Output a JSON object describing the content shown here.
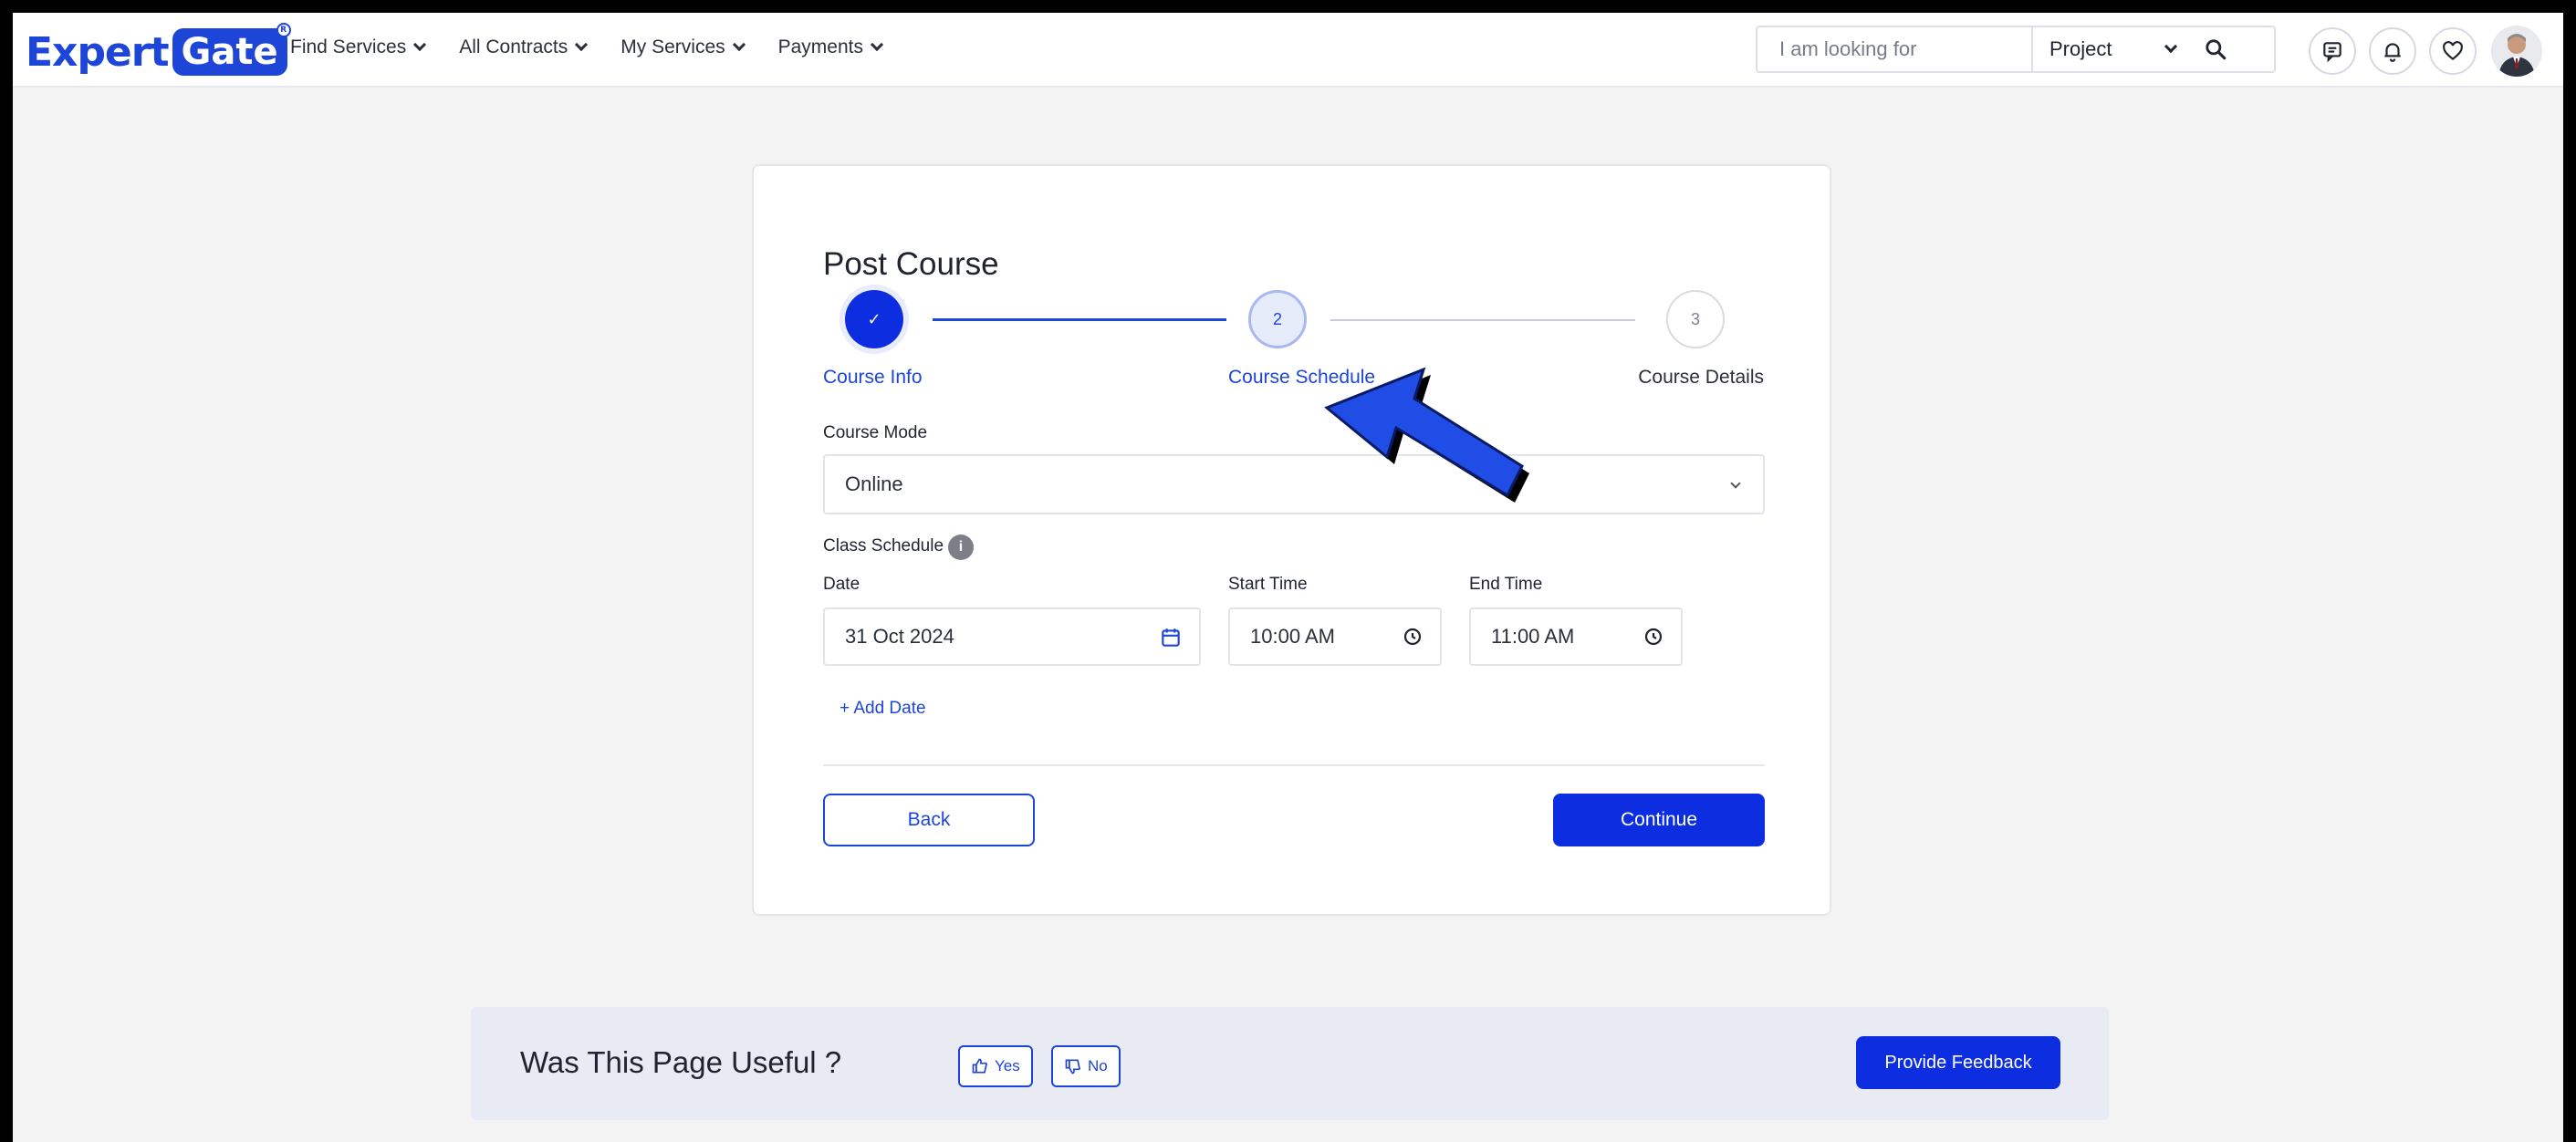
{
  "brand": {
    "part1": "Expert",
    "part2": "Gate",
    "reg": "R"
  },
  "nav": {
    "items": [
      "Find Services",
      "All Contracts",
      "My Services",
      "Payments"
    ]
  },
  "search": {
    "placeholder": "I am looking for",
    "category": "Project"
  },
  "header_icons": [
    "chat-icon",
    "bell-icon",
    "heart-icon",
    "avatar"
  ],
  "form": {
    "title": "Post Course",
    "steps": [
      {
        "label": "Course Info",
        "state": "done",
        "marker": "✓"
      },
      {
        "label": "Course Schedule",
        "state": "active",
        "marker": "2"
      },
      {
        "label": "Course Details",
        "state": "todo",
        "marker": "3"
      }
    ],
    "course_mode_label": "Course Mode",
    "course_mode_value": "Online",
    "class_schedule_label": "Class Schedule",
    "info_glyph": "i",
    "date_label": "Date",
    "date_value": "31 Oct 2024",
    "start_label": "Start Time",
    "start_value": "10:00 AM",
    "end_label": "End Time",
    "end_value": "11:00 AM",
    "add_date": "+ Add Date",
    "back": "Back",
    "continue": "Continue"
  },
  "feedback": {
    "question": "Was This Page Useful ?",
    "yes": "Yes",
    "no": "No",
    "provide": "Provide Feedback"
  },
  "colors": {
    "primary": "#0d2ee0",
    "link": "#1d45d8",
    "page_bg": "#f3f3f4",
    "feedback_bg": "#e8eaf4"
  }
}
